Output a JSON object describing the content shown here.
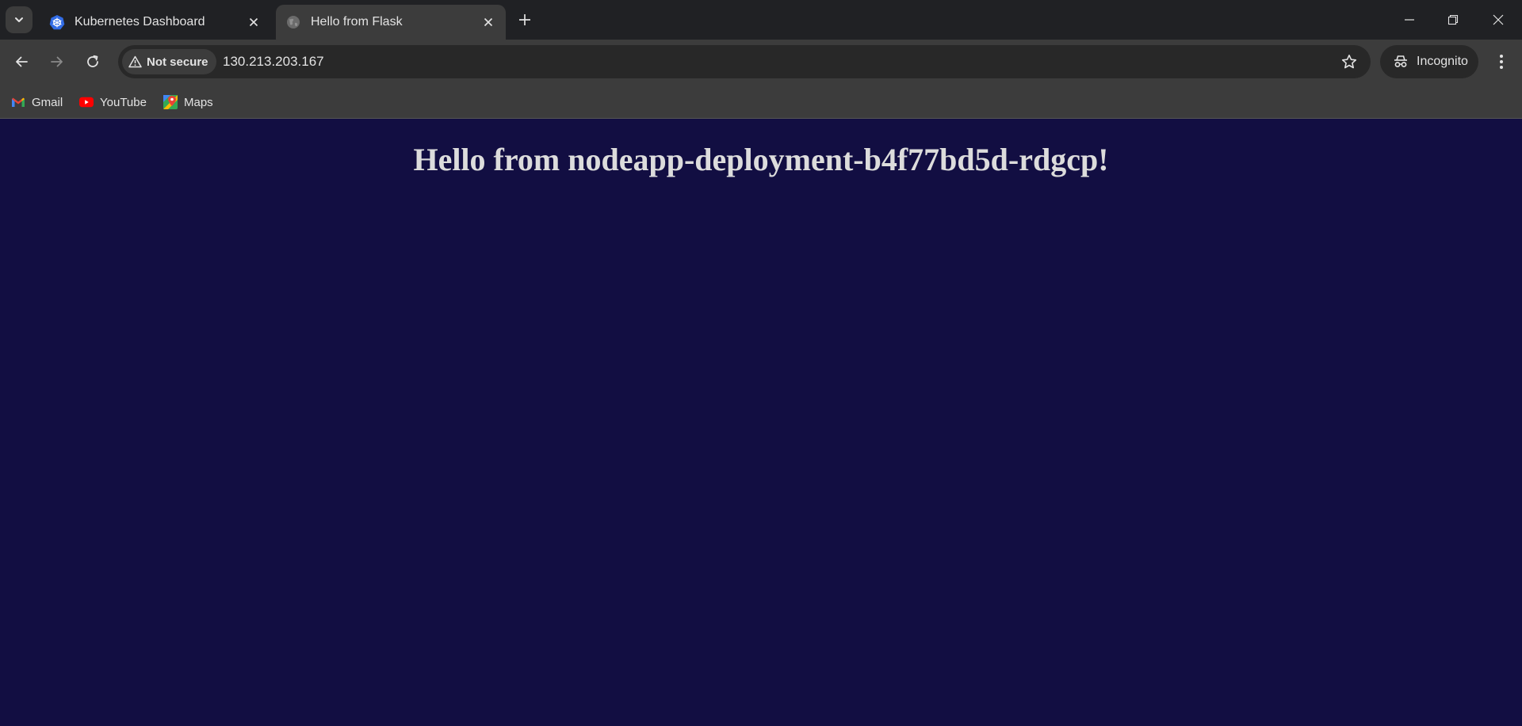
{
  "browser": {
    "tabs": [
      {
        "title": "Kubernetes Dashboard",
        "favicon": "kubernetes-icon",
        "active": false
      },
      {
        "title": "Hello from Flask",
        "favicon": "globe-icon",
        "active": true
      }
    ],
    "address_bar": {
      "security_label": "Not secure",
      "url": "130.213.203.167"
    },
    "profile_label": "Incognito",
    "bookmarks": [
      {
        "label": "Gmail",
        "icon": "gmail-icon"
      },
      {
        "label": "YouTube",
        "icon": "youtube-icon"
      },
      {
        "label": "Maps",
        "icon": "maps-icon"
      }
    ]
  },
  "page": {
    "heading": "Hello from nodeapp-deployment-b4f77bd5d-rdgcp!",
    "background_color": "#120e42"
  }
}
